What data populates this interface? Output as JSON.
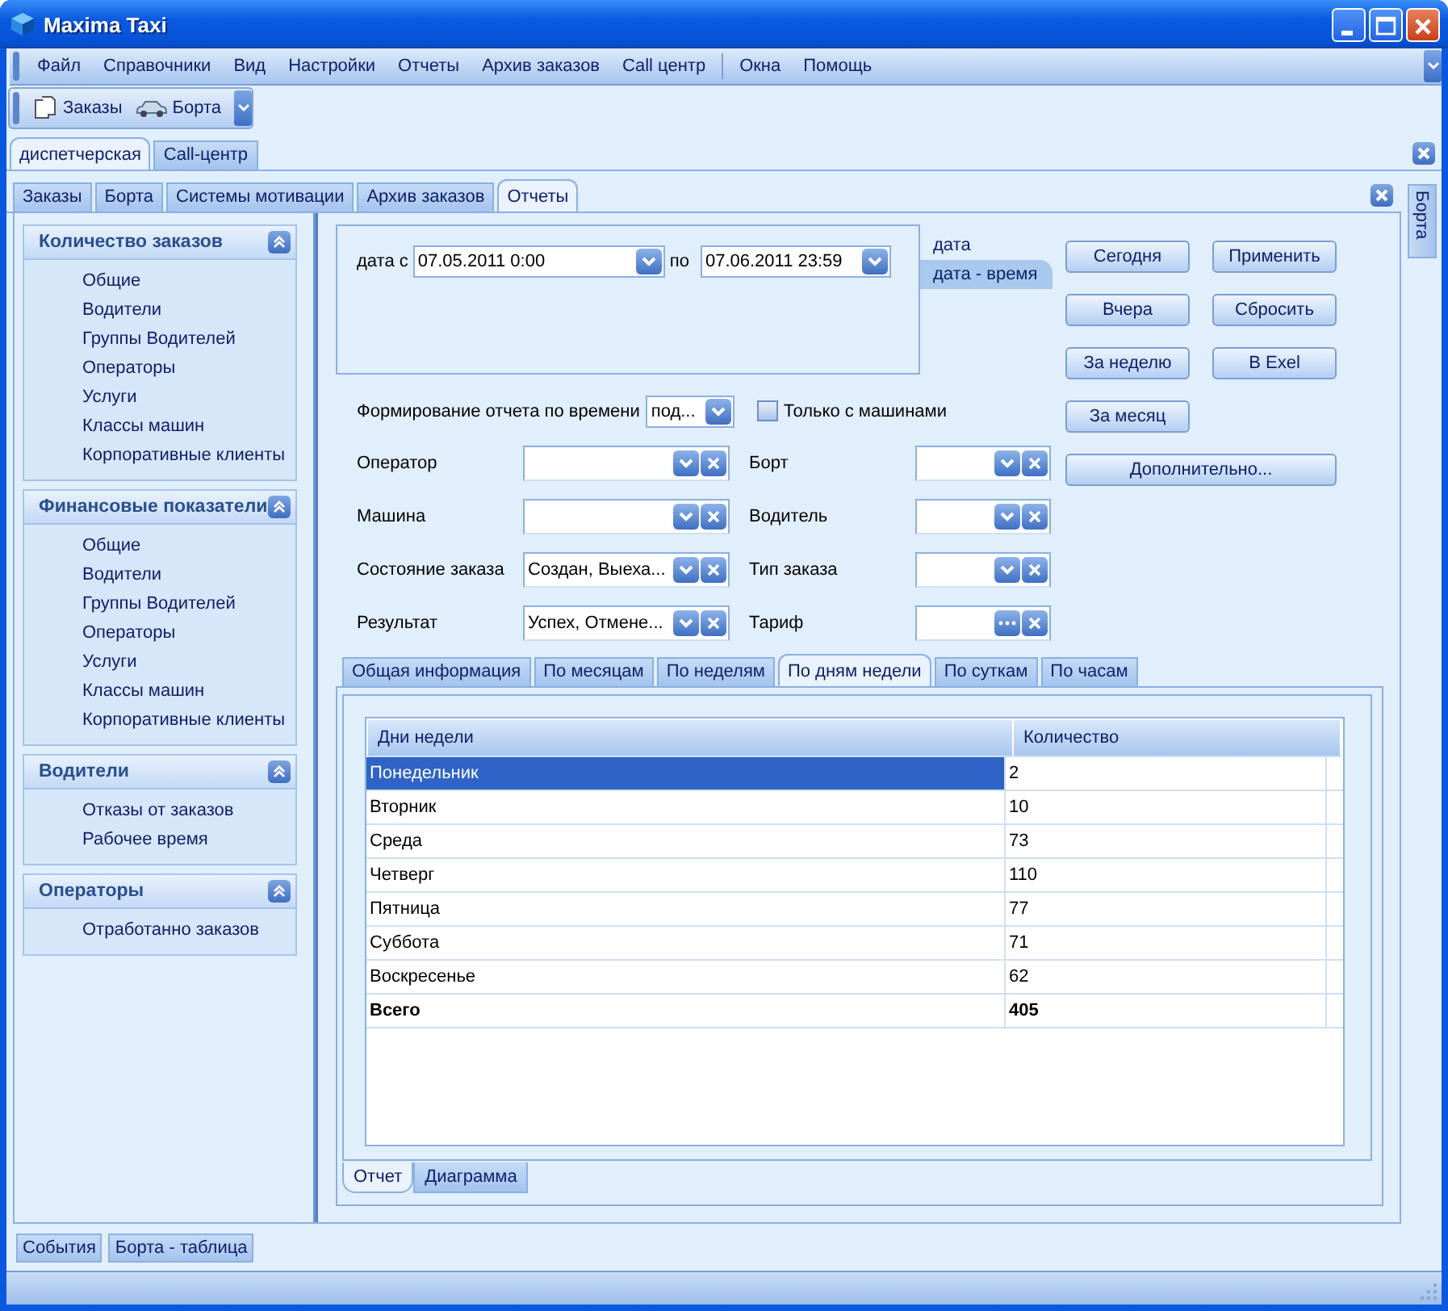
{
  "window": {
    "title": "Maxima Taxi"
  },
  "menu": [
    {
      "label": "Файл",
      "separator_before": false
    },
    {
      "label": "Справочники",
      "separator_before": false
    },
    {
      "label": "Вид",
      "separator_before": false
    },
    {
      "label": "Настройки",
      "separator_before": false
    },
    {
      "label": "Отчеты",
      "separator_before": false
    },
    {
      "label": "Архив заказов",
      "separator_before": false
    },
    {
      "label": "Call центр",
      "separator_before": false
    },
    {
      "label": "Окна",
      "separator_before": true
    },
    {
      "label": "Помощь",
      "separator_before": false
    }
  ],
  "toolbar": [
    {
      "label": "Заказы",
      "kind": "document"
    },
    {
      "label": "Борта",
      "kind": "car"
    }
  ],
  "top_tabs": [
    {
      "label": "диспетчерская",
      "selected": true
    },
    {
      "label": "Call-центр",
      "selected": false
    }
  ],
  "sub_tabs": [
    {
      "label": "Заказы",
      "selected": false
    },
    {
      "label": "Борта",
      "selected": false
    },
    {
      "label": "Системы мотивации",
      "selected": false
    },
    {
      "label": "Архив заказов",
      "selected": false
    },
    {
      "label": "Отчеты",
      "selected": true
    }
  ],
  "side_tab": {
    "label": "Борта"
  },
  "sidebar": {
    "groups": [
      {
        "title": "Количество заказов",
        "expanded": true,
        "items": [
          "Общие",
          "Водители",
          "Группы Водителей",
          "Операторы",
          "Услуги",
          "Классы машин",
          "Корпоративные клиенты"
        ]
      },
      {
        "title": "Финансовые показатели",
        "expanded": true,
        "items": [
          "Общие",
          "Водители",
          "Группы Водителей",
          "Операторы",
          "Услуги",
          "Классы машин",
          "Корпоративные клиенты"
        ]
      },
      {
        "title": "Водители",
        "expanded": true,
        "items": [
          "Отказы от заказов",
          "Рабочее время"
        ]
      },
      {
        "title": "Операторы",
        "expanded": true,
        "items": [
          "Отработанно заказов"
        ]
      }
    ]
  },
  "date_range": {
    "from_label": "дата с",
    "from_value": "07.05.2011 0:00",
    "to_label": "по",
    "to_value": "07.06.2011 23:59",
    "modes": [
      {
        "label": "дата",
        "selected": false
      },
      {
        "label": "дата - время",
        "selected": true
      }
    ]
  },
  "buttons": [
    {
      "label": "Сегодня",
      "kind": "normal"
    },
    {
      "label": "Применить",
      "kind": "normal"
    },
    {
      "label": "Вчера",
      "kind": "normal"
    },
    {
      "label": "Сбросить",
      "kind": "normal"
    },
    {
      "label": "За неделю",
      "kind": "normal"
    },
    {
      "label": "В Exel",
      "kind": "normal"
    },
    {
      "label": "За месяц",
      "kind": "normal"
    },
    {
      "label": "Дополнительно...",
      "kind": "wide"
    }
  ],
  "time_grouping": {
    "label": "Формирование отчета по времени",
    "value": "под..."
  },
  "only_with_cars": {
    "label": "Только с машинами",
    "checked": false
  },
  "filters": [
    {
      "label": "Оператор",
      "kind": "dropdown"
    },
    {
      "label": "Борт",
      "kind": "dropdown"
    },
    {
      "label": "Машина",
      "kind": "dropdown"
    },
    {
      "label": "Водитель",
      "kind": "dropdown"
    },
    {
      "label": "Состояние заказа",
      "kind": "dropdown",
      "value": "Создан, Выеха..."
    },
    {
      "label": "Тип заказа",
      "kind": "dropdown"
    },
    {
      "label": "Результат",
      "kind": "dropdown",
      "value": "Успех, Отмене..."
    },
    {
      "label": "Тариф",
      "kind": "ellipsis"
    }
  ],
  "report_tabs": [
    {
      "label": "Общая информация",
      "selected": false
    },
    {
      "label": "По месяцам",
      "selected": false
    },
    {
      "label": "По неделям",
      "selected": false
    },
    {
      "label": "По дням недели",
      "selected": true
    },
    {
      "label": "По суткам",
      "selected": false
    },
    {
      "label": "По часам",
      "selected": false
    }
  ],
  "table": {
    "columns": [
      "Дни недели",
      "Количество"
    ],
    "rows": [
      {
        "cells": [
          "Понедельник",
          "2"
        ],
        "selected": true,
        "total": false
      },
      {
        "cells": [
          "Вторник",
          "10"
        ],
        "selected": false,
        "total": false
      },
      {
        "cells": [
          "Среда",
          "73"
        ],
        "selected": false,
        "total": false
      },
      {
        "cells": [
          "Четверг",
          "110"
        ],
        "selected": false,
        "total": false
      },
      {
        "cells": [
          "Пятница",
          "77"
        ],
        "selected": false,
        "total": false
      },
      {
        "cells": [
          "Суббота",
          "71"
        ],
        "selected": false,
        "total": false
      },
      {
        "cells": [
          "Воскресенье",
          "62"
        ],
        "selected": false,
        "total": false
      },
      {
        "cells": [
          "Всего",
          "405"
        ],
        "selected": false,
        "total": true
      }
    ]
  },
  "view_tabs": [
    {
      "label": "Отчет",
      "selected": true
    },
    {
      "label": "Диаграмма",
      "selected": false
    }
  ],
  "bottom_tabs": [
    "События",
    "Борта - таблица"
  ]
}
